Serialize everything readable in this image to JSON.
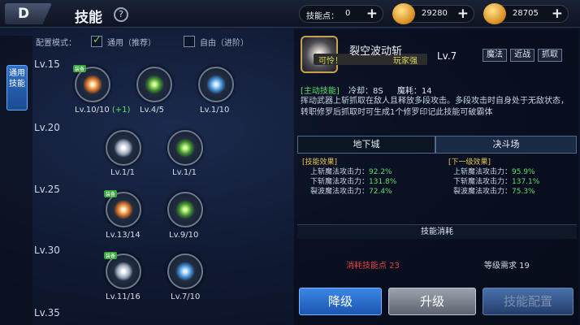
{
  "header": {
    "back_glyph": "D",
    "title": "技能",
    "help_glyph": "?"
  },
  "resources": {
    "skill_points_label": "技能点：",
    "skill_points_value": "0",
    "gold_value": "29280",
    "coin_value": "28705",
    "plus": "+"
  },
  "sidebar": {
    "general_tab": "通用技能"
  },
  "config": {
    "label": "配置模式：",
    "option_general": "通用（推荐）",
    "option_free": "自由（进阶）",
    "selected": "general"
  },
  "levels": [
    "Lv.15",
    "Lv.20",
    "Lv.25",
    "Lv.30",
    "Lv.35"
  ],
  "nodes": [
    {
      "label": "Lv.10/10",
      "extra": "(+1)",
      "tag": "装备"
    },
    {
      "label": "Lv.4/5"
    },
    {
      "label": "Lv.1/10"
    },
    {
      "label": "Lv.1/1"
    },
    {
      "label": "Lv.1/1"
    },
    {
      "label": "Lv.13/14",
      "tag": "装备"
    },
    {
      "label": "Lv.9/10"
    },
    {
      "label": "Lv.11/16",
      "tag": "装备"
    },
    {
      "label": "Lv.7/10"
    }
  ],
  "detail": {
    "name": "裂空波动斩",
    "level": "Lv.7",
    "overlay_text": "可怜！",
    "overlay_text2": "玩家强",
    "tags": [
      "魔法",
      "近战",
      "抓取"
    ],
    "type": "[主动技能]",
    "cooldown_label": "冷却：",
    "cooldown_value": "8S",
    "mana_label": "魔耗：",
    "mana_value": "14",
    "description": "挥动武器上斩抓取在敌人且释放多段攻击。多段攻击时自身处于无敌状态，转职修罗后抓取时可生成1个修罗印记此技能可破霸体",
    "tab_dungeon": "地下城",
    "tab_arena": "决斗场",
    "current_header": "[技能效果]",
    "next_header": "[下一级效果]",
    "effects": [
      {
        "name": "上斩魔法攻击力：",
        "current": "92.2%",
        "next": "95.9%"
      },
      {
        "name": "下斩魔法攻击力：",
        "current": "131.8%",
        "next": "137.1%"
      },
      {
        "name": "裂波魔法攻击力：",
        "current": "72.4%",
        "next": "75.3%"
      }
    ],
    "cost_title": "技能消耗",
    "cost_text": "消耗技能点 23",
    "req_text": "等级需求 19"
  },
  "buttons": {
    "downgrade": "降级",
    "upgrade": "升级",
    "config": "技能配置"
  }
}
